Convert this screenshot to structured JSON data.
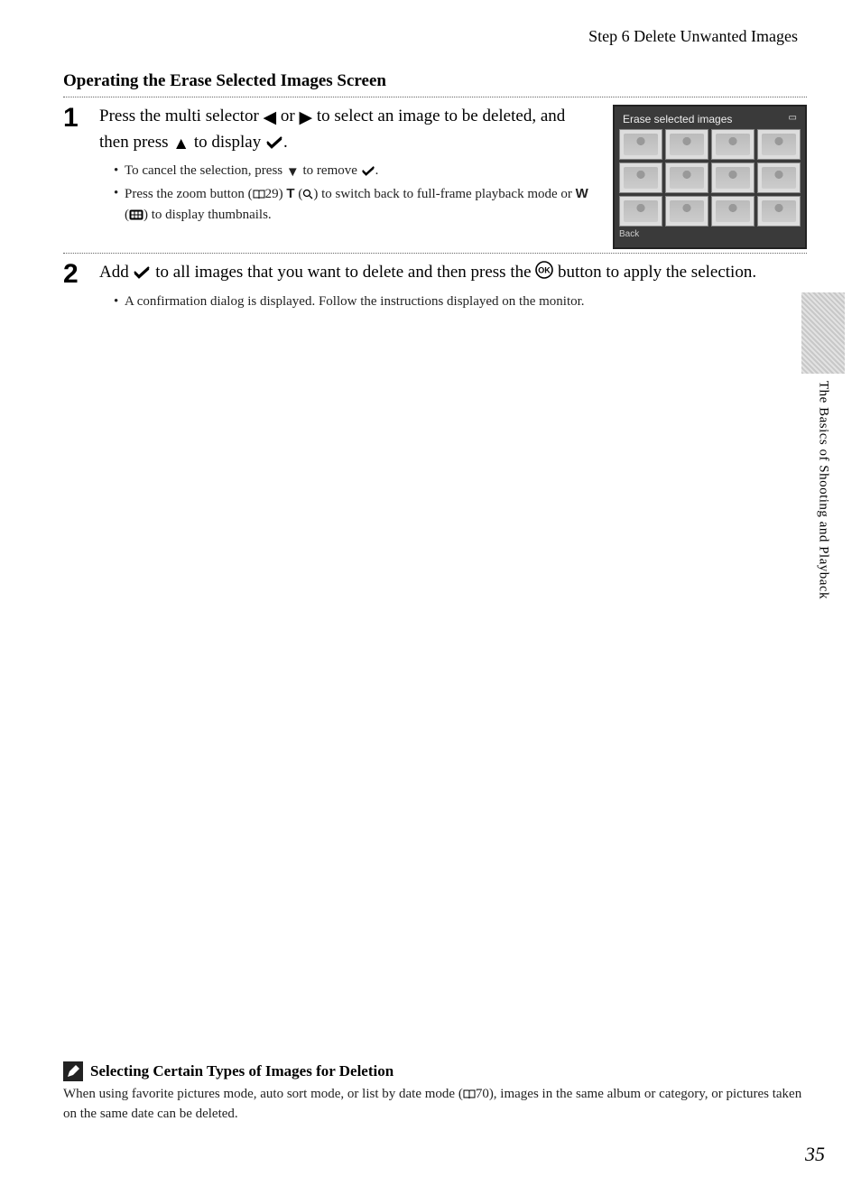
{
  "header": "Step 6 Delete Unwanted Images",
  "section_title": "Operating the Erase Selected Images Screen",
  "step1": {
    "num": "1",
    "text_a": "Press the multi selector ",
    "text_b": " or ",
    "text_c": " to select an image to be deleted, and then press ",
    "text_d": " to display ",
    "text_e": ".",
    "bullet1_a": "To cancel the selection, press ",
    "bullet1_b": " to remove ",
    "bullet1_c": ".",
    "bullet2_a": "Press the zoom button (",
    "bullet2_ref": "29",
    "bullet2_b": ") ",
    "bullet2_T": "T",
    "bullet2_c": " (",
    "bullet2_d": ") to switch back to full-frame playback mode or ",
    "bullet2_W": "W",
    "bullet2_e": " (",
    "bullet2_f": ") to display thumbnails."
  },
  "step2": {
    "num": "2",
    "text_a": "Add ",
    "text_b": " to all images that you want to delete and then press the ",
    "text_c": " button to apply the selection.",
    "bullet1": "A confirmation dialog is displayed. Follow the instructions displayed on the monitor."
  },
  "screen": {
    "title": "Erase selected images",
    "left": "Back",
    "right": ""
  },
  "side_tab": "The Basics of Shooting and Playback",
  "note": {
    "title": "Selecting Certain Types of Images for Deletion",
    "body_a": "When using favorite pictures mode, auto sort mode, or list by date mode (",
    "body_ref": "70",
    "body_b": "), images in the same album or category, or pictures taken on the same date can be deleted."
  },
  "page_number": "35"
}
